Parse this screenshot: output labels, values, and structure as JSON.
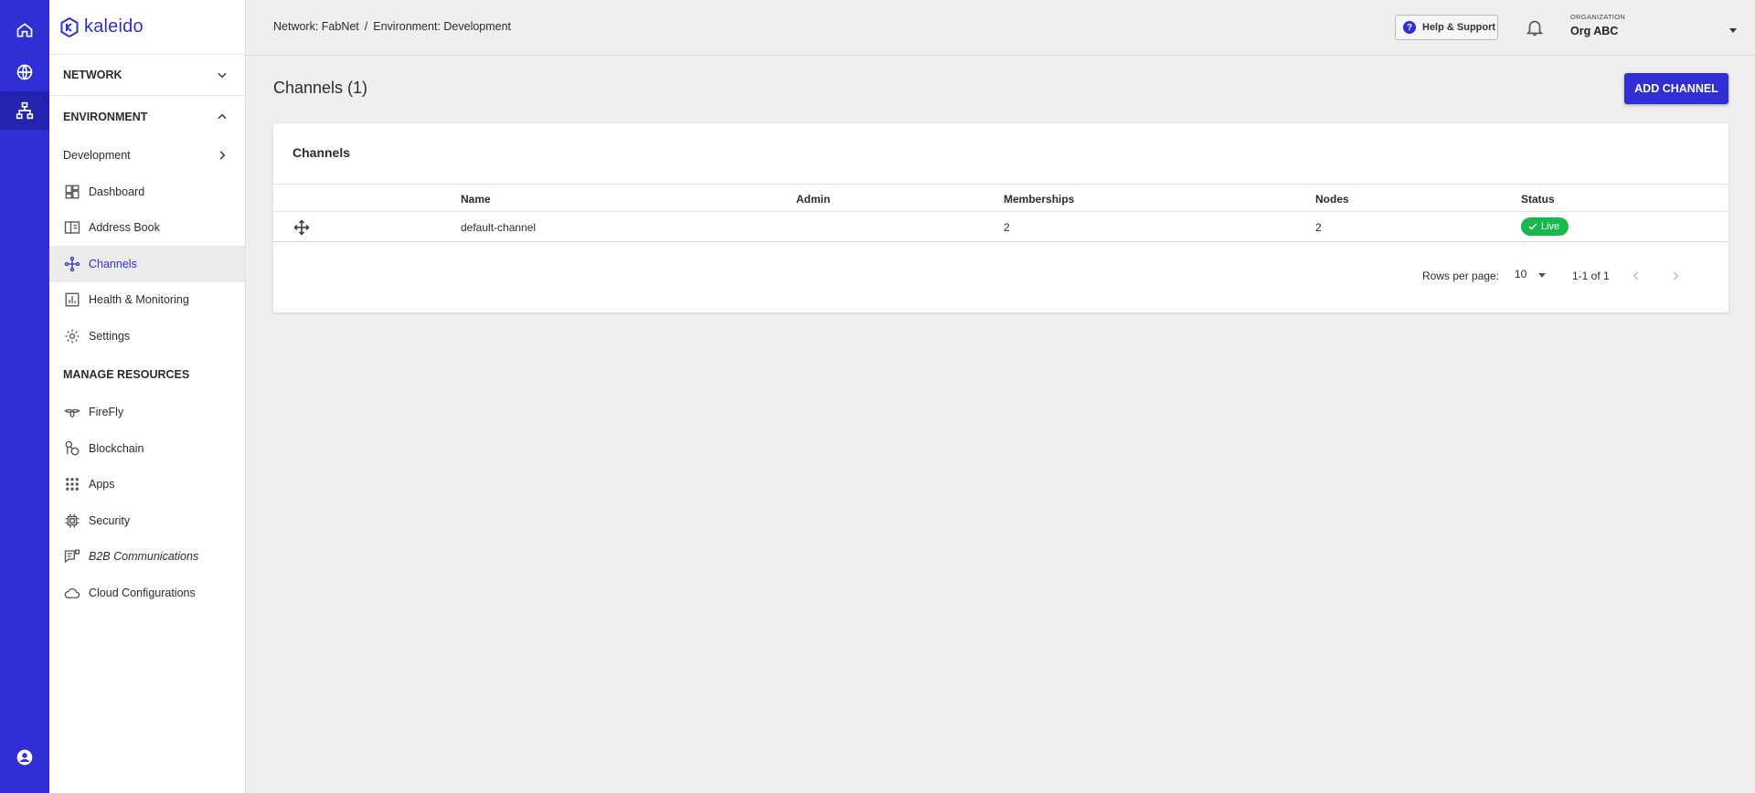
{
  "brand": {
    "name": "kaleido"
  },
  "rail": {
    "items": [
      {
        "icon": "home-icon"
      },
      {
        "icon": "globe-icon"
      },
      {
        "icon": "network-tree-icon"
      }
    ],
    "bottom_icon": "account-circle-icon"
  },
  "sidebar": {
    "network_label": "NETWORK",
    "environment_label": "ENVIRONMENT",
    "environment_name": "Development",
    "env_items": [
      {
        "label": "Dashboard",
        "icon": "dashboard-icon"
      },
      {
        "label": "Address Book",
        "icon": "address-book-icon"
      },
      {
        "label": "Channels",
        "icon": "channels-icon"
      },
      {
        "label": "Health & Monitoring",
        "icon": "bar-chart-icon"
      },
      {
        "label": "Settings",
        "icon": "gear-icon"
      }
    ],
    "manage_resources_label": "MANAGE RESOURCES",
    "resource_items": [
      {
        "label": "FireFly",
        "icon": "firefly-icon"
      },
      {
        "label": "Blockchain",
        "icon": "blockchain-icon"
      },
      {
        "label": "Apps",
        "icon": "apps-grid-icon"
      },
      {
        "label": "Security",
        "icon": "security-chip-icon"
      },
      {
        "label": "B2B Communications",
        "icon": "b2b-message-icon"
      },
      {
        "label": "Cloud Configurations",
        "icon": "cloud-icon"
      }
    ]
  },
  "topbar": {
    "breadcrumb_network": "Network: FabNet",
    "breadcrumb_sep": "/",
    "breadcrumb_env": "Environment: Development",
    "help_label": "Help & Support",
    "org_label": "ORGANIZATION",
    "org_name": "Org ABC"
  },
  "main": {
    "page_title": "Channels (1)",
    "add_button": "ADD CHANNEL",
    "card_title": "Channels",
    "columns": [
      "Name",
      "Admin",
      "Memberships",
      "Nodes",
      "Status"
    ],
    "rows": [
      {
        "name": "default-channel",
        "admin": "",
        "memberships": "2",
        "nodes": "2",
        "status": "Live"
      }
    ],
    "rows_per_page_label": "Rows per page:",
    "rows_per_page_value": "10",
    "range_label": "1-1 of 1"
  },
  "colors": {
    "accent": "#2f2fd5",
    "live_badge": "#19b84d",
    "background": "#efefef"
  }
}
